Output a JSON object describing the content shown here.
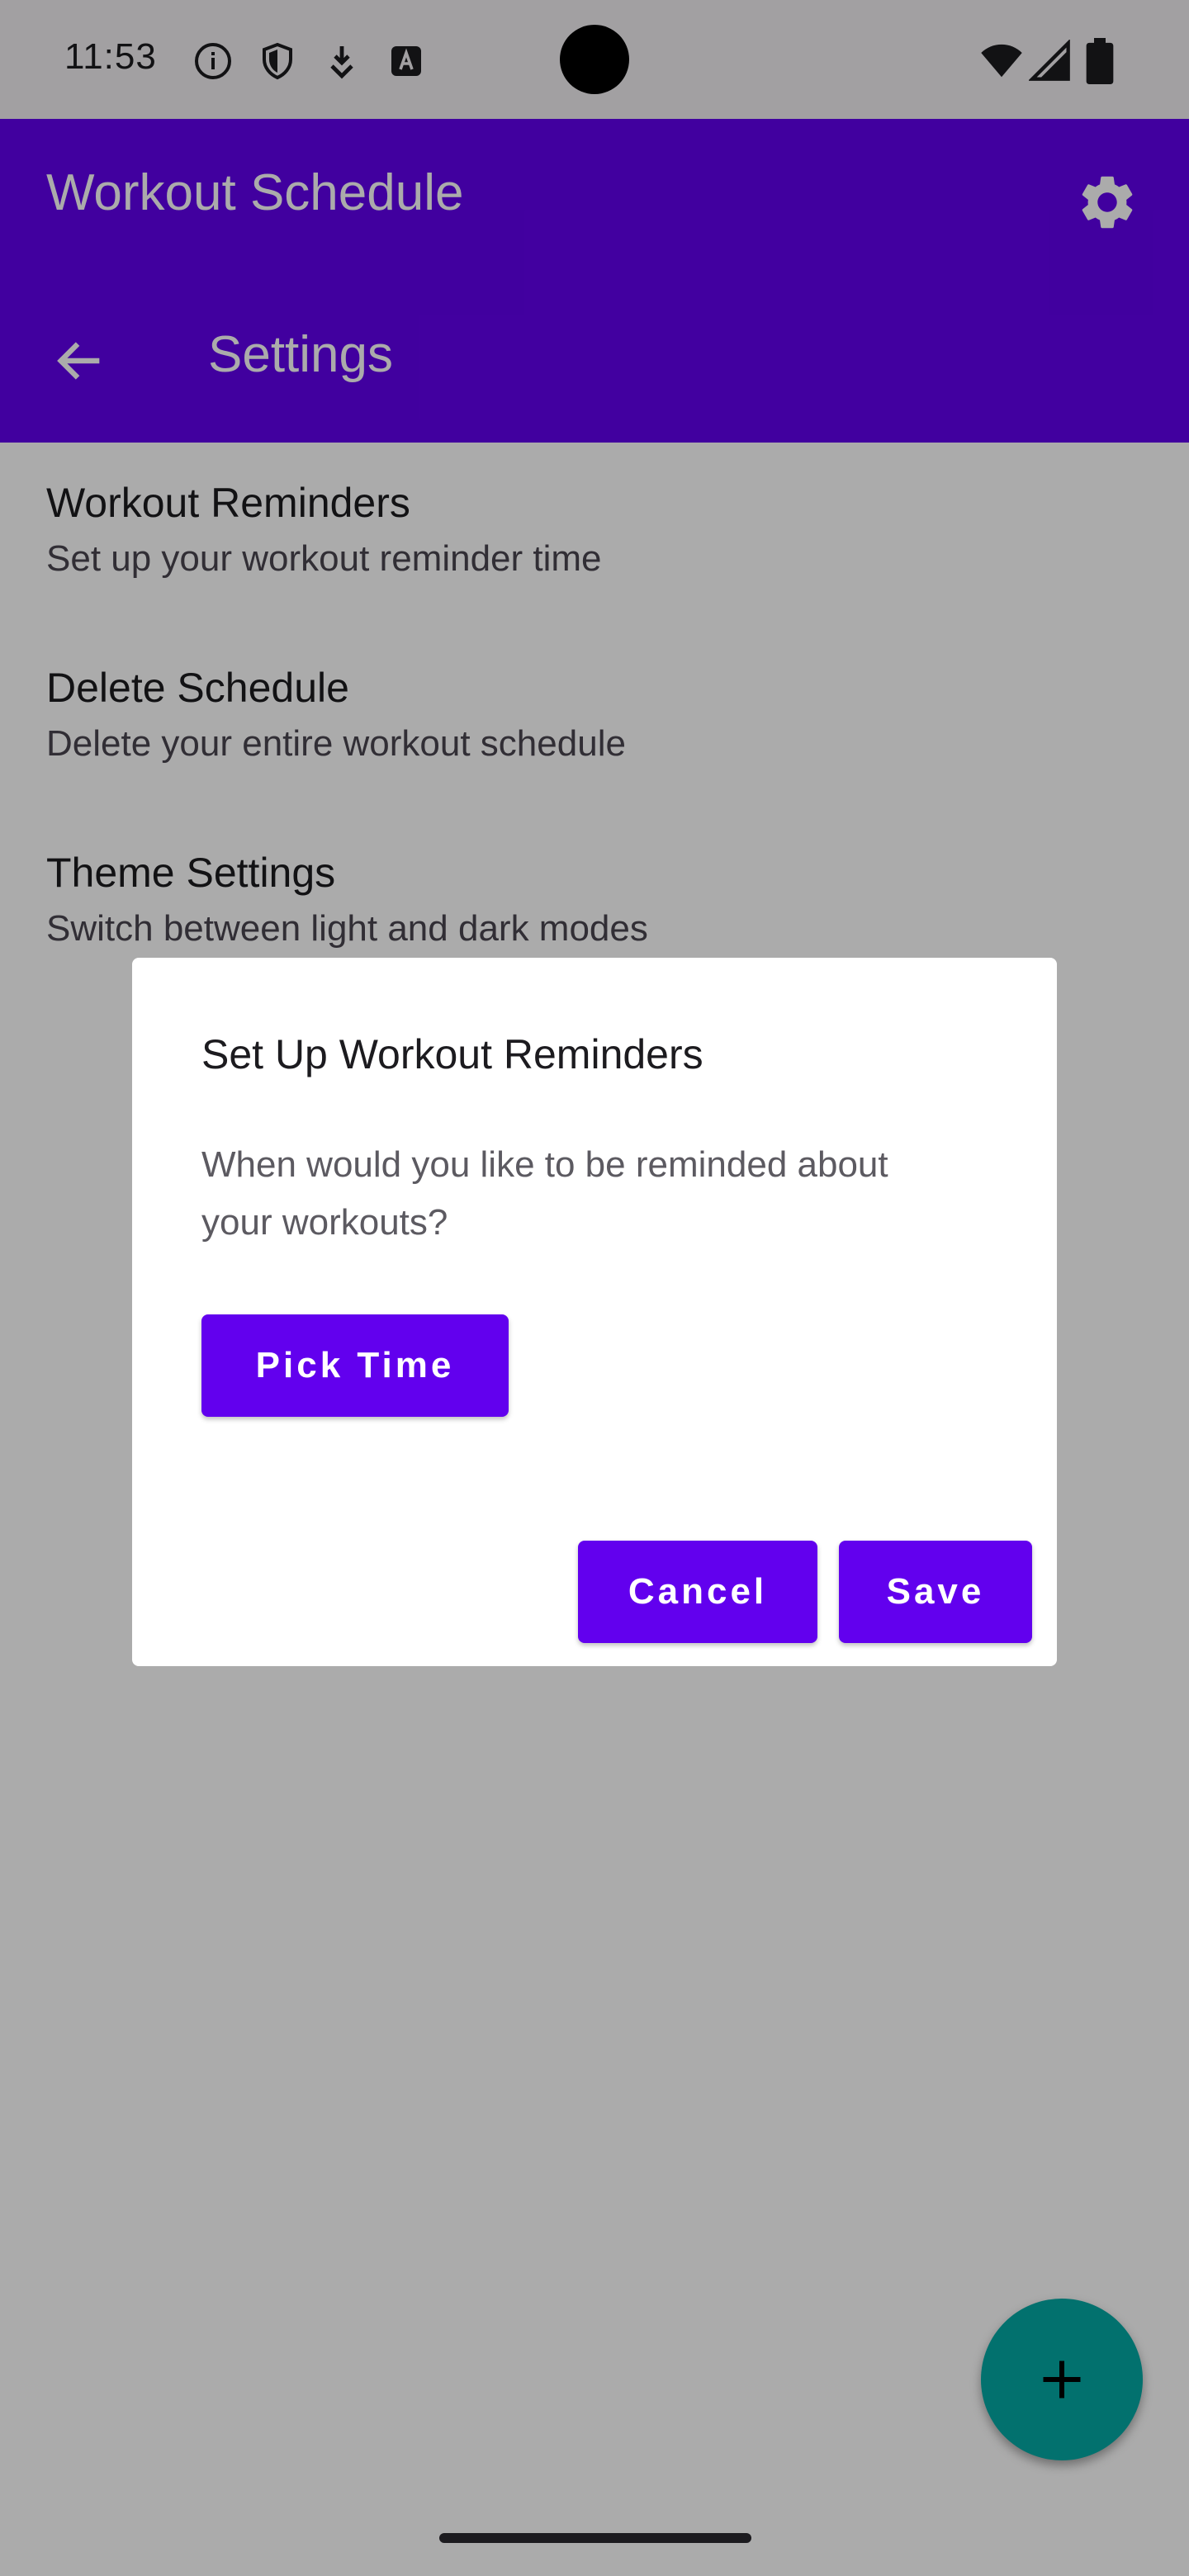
{
  "status_bar": {
    "time": "11:53",
    "icons": [
      "info-icon",
      "shield-icon",
      "download-icon",
      "keyboard-a-icon",
      "wifi-icon",
      "signal-icon",
      "battery-icon"
    ]
  },
  "app_bar": {
    "title": "Workout Schedule",
    "subtitle": "Settings",
    "color": "#6200EE"
  },
  "settings": [
    {
      "title": "Workout Reminders",
      "subtitle": "Set up your workout reminder time"
    },
    {
      "title": "Delete Schedule",
      "subtitle": "Delete your entire workout schedule"
    },
    {
      "title": "Theme Settings",
      "subtitle": "Switch between light and dark modes"
    }
  ],
  "dialog": {
    "title": "Set Up Workout Reminders",
    "message": "When would you like to be reminded about your workouts?",
    "pick_time_label": "Pick Time",
    "cancel_label": "Cancel",
    "save_label": "Save",
    "button_color": "#6200EE"
  },
  "fab": {
    "icon": "plus-icon",
    "color": "#03A9A4"
  }
}
